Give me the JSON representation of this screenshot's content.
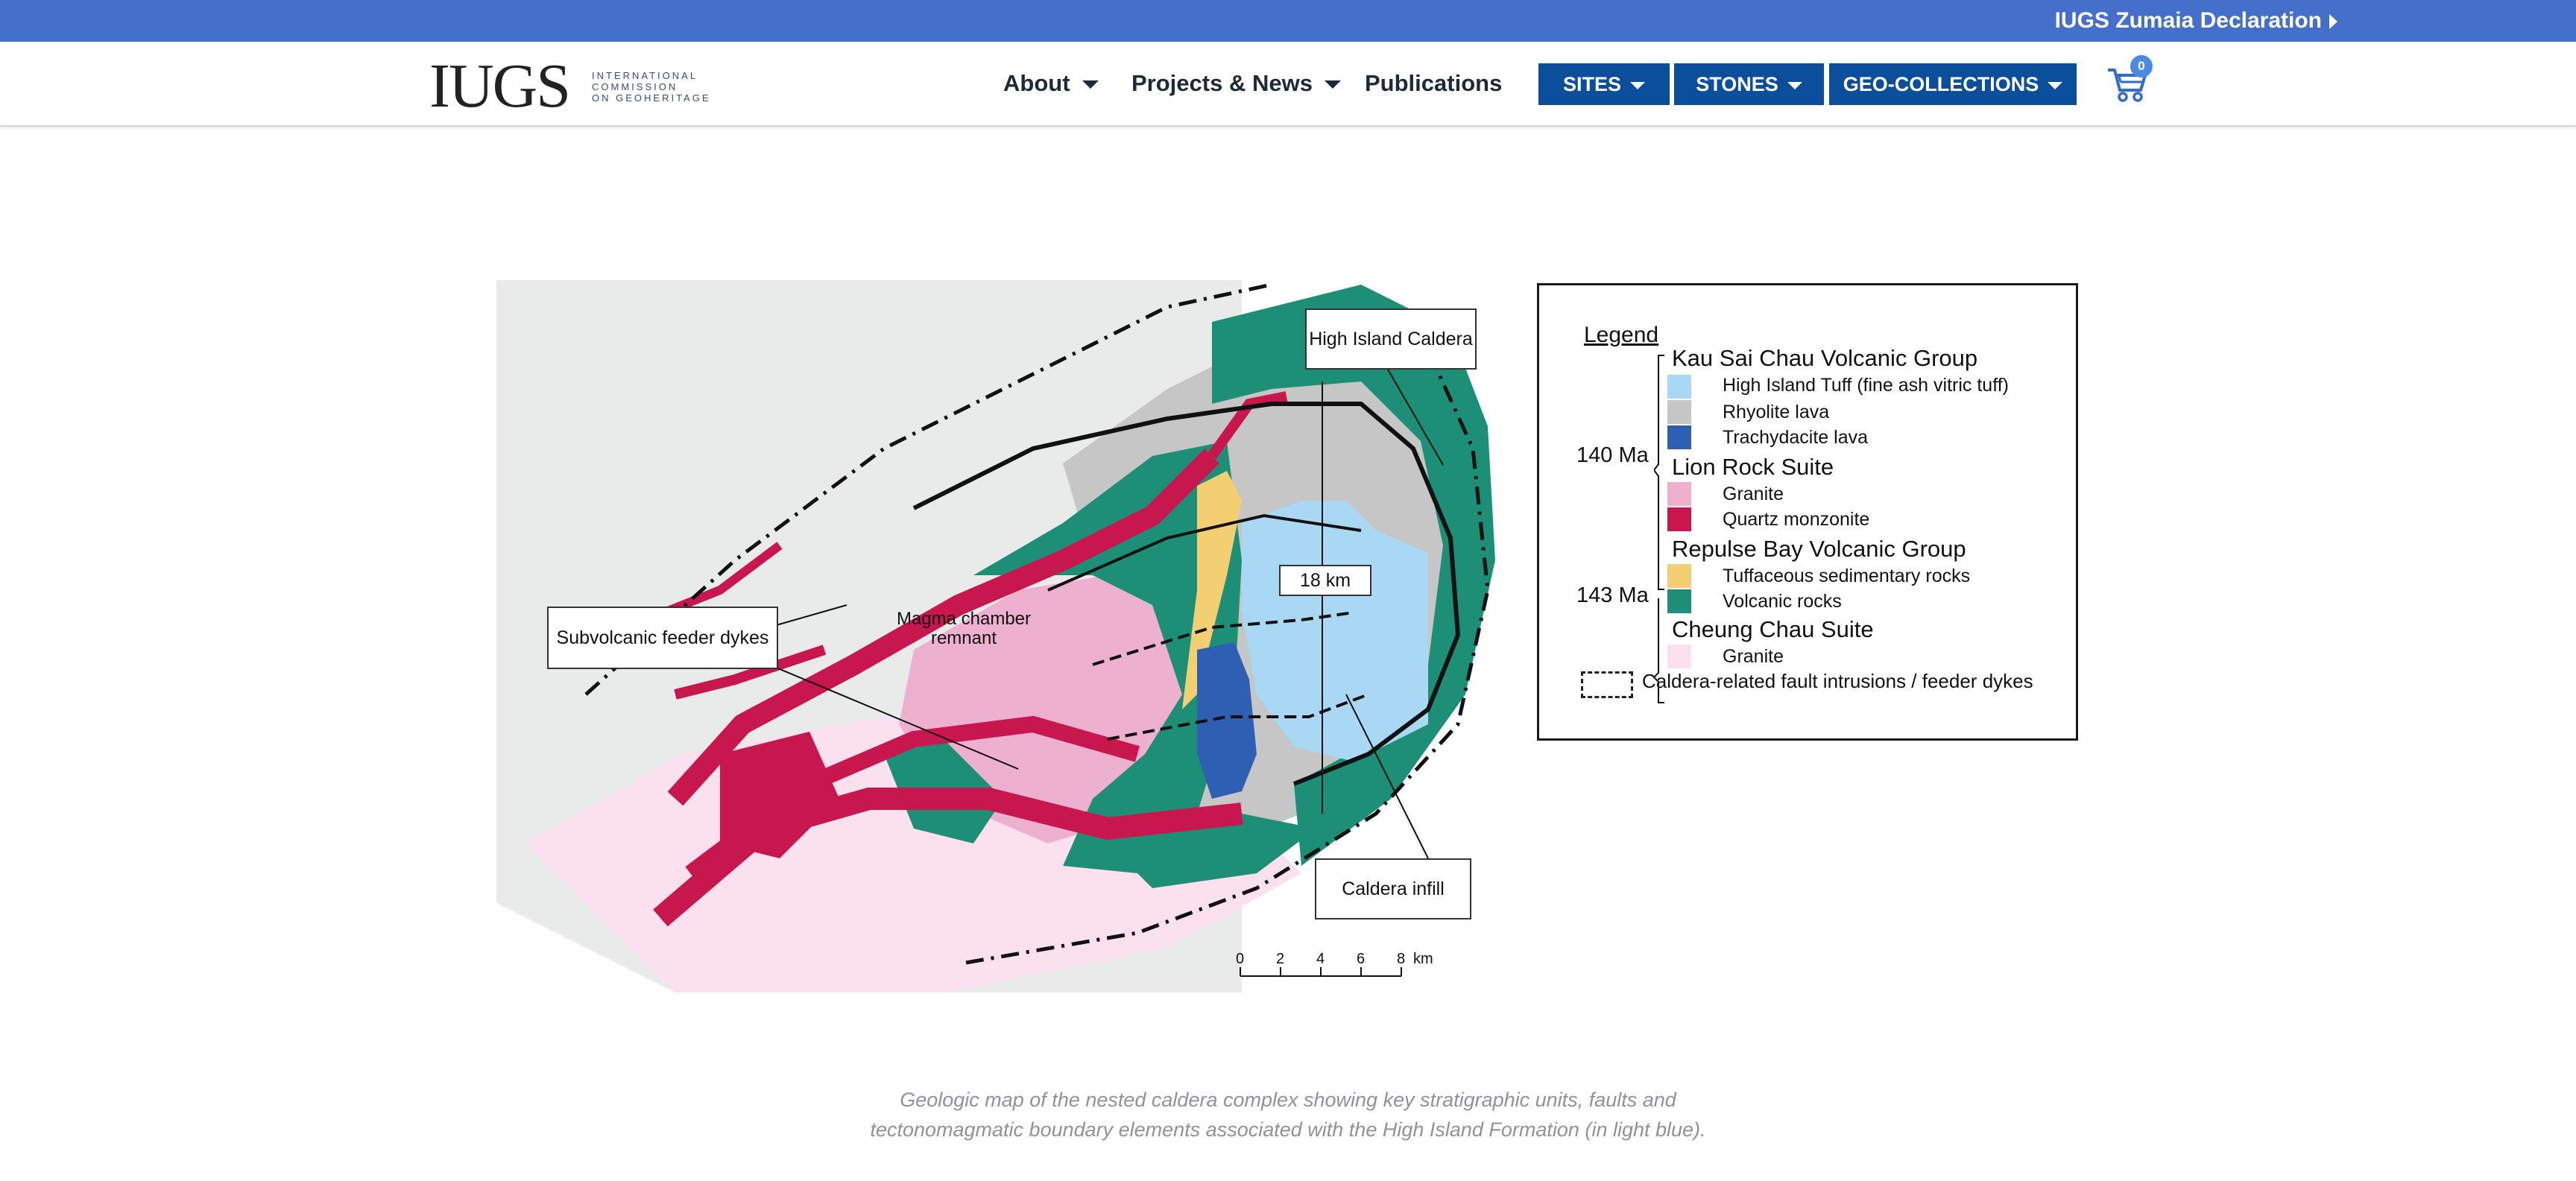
{
  "topbar": {
    "link": "IUGS Zumaia Declaration"
  },
  "logo": {
    "mark": "IUGS",
    "sub": [
      "INTERNATIONAL",
      "COMMISSION",
      "ON GEOHERITAGE"
    ]
  },
  "nav": {
    "about": "About",
    "projects": "Projects & News",
    "publications": "Publications",
    "sites": "SITES",
    "stones": "STONES",
    "collections": "GEO-COLLECTIONS",
    "cart_count": "0"
  },
  "figure": {
    "callout_high_island": "High Island Caldera",
    "callout_18km": "18 km",
    "callout_feeder": "Subvolcanic feeder dykes",
    "callout_infill": "Caldera infill",
    "magma_line1": "Magma chamber",
    "magma_line2": "remnant",
    "scale_ticks": [
      "0",
      "2",
      "4",
      "6",
      "8"
    ],
    "scale_unit": "km",
    "legend": {
      "title": "Legend",
      "age_140": "140 Ma",
      "age_143": "143 Ma",
      "groups": [
        {
          "name": "Kau Sai Chau Volcanic Group",
          "items": [
            {
              "label": "High Island Tuff (fine ash vitric tuff)",
              "color": "#a9d8f5"
            },
            {
              "label": "Rhyolite lava",
              "color": "#c6c6c6"
            },
            {
              "label": "Trachydacite lava",
              "color": "#2e5fb2"
            }
          ]
        },
        {
          "name": "Lion Rock Suite",
          "items": [
            {
              "label": "Granite",
              "color": "#eeb0cf"
            },
            {
              "label": "Quartz monzonite",
              "color": "#c8174f"
            }
          ]
        },
        {
          "name": "Repulse Bay Volcanic Group",
          "items": [
            {
              "label": "Tuffaceous sedimentary rocks",
              "color": "#f3cf72"
            },
            {
              "label": "Volcanic rocks",
              "color": "#1d8f76"
            }
          ]
        },
        {
          "name": "Cheung Chau Suite",
          "items": [
            {
              "label": "Granite",
              "color": "#fbe1ee"
            }
          ]
        }
      ],
      "dyke_label": "Caldera-related fault intrusions / feeder dykes"
    },
    "caption_line1": "Geologic map of the nested caldera complex showing key stratigraphic units, faults and",
    "caption_line2": "tectonomagmatic boundary elements associated with the High Island Formation (in light blue)."
  }
}
